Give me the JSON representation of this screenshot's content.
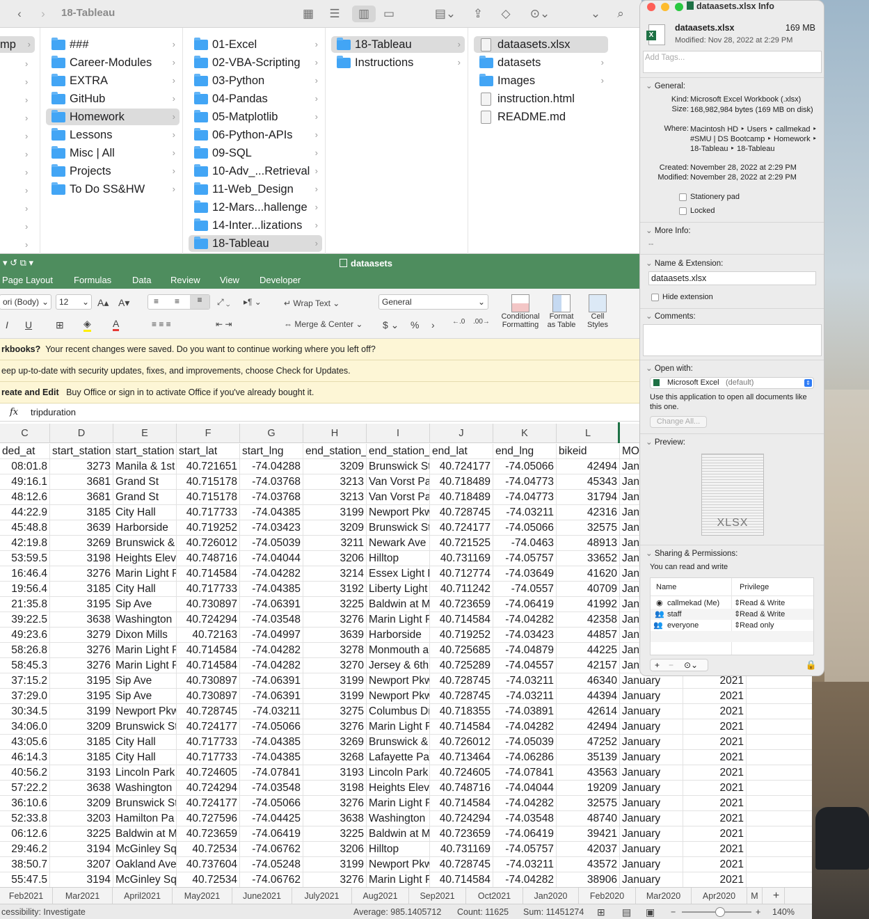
{
  "finder": {
    "title": "18-Tableau",
    "col0": [
      {
        "label": "mp",
        "selected": true
      }
    ],
    "col1": [
      {
        "label": "###",
        "selected": false
      },
      {
        "label": "Career-Modules",
        "selected": false
      },
      {
        "label": "EXTRA",
        "selected": false
      },
      {
        "label": "GitHub",
        "selected": false
      },
      {
        "label": "Homework",
        "selected": true
      },
      {
        "label": "Lessons",
        "selected": false
      },
      {
        "label": "Misc | All",
        "selected": false
      },
      {
        "label": "Projects",
        "selected": false
      },
      {
        "label": "To Do SS&HW",
        "selected": false
      }
    ],
    "col2": [
      {
        "label": "01-Excel",
        "selected": false
      },
      {
        "label": "02-VBA-Scripting",
        "selected": false
      },
      {
        "label": "03-Python",
        "selected": false
      },
      {
        "label": "04-Pandas",
        "selected": false
      },
      {
        "label": "05-Matplotlib",
        "selected": false
      },
      {
        "label": "06-Python-APIs",
        "selected": false
      },
      {
        "label": "09-SQL",
        "selected": false
      },
      {
        "label": "10-Adv_...Retrieval",
        "selected": false
      },
      {
        "label": "11-Web_Design",
        "selected": false
      },
      {
        "label": "12-Mars...hallenge",
        "selected": false
      },
      {
        "label": "14-Inter...lizations",
        "selected": false
      },
      {
        "label": "18-Tableau",
        "selected": true
      }
    ],
    "col3": [
      {
        "label": "18-Tableau",
        "selected": true
      },
      {
        "label": "Instructions",
        "selected": false
      }
    ],
    "col4": [
      {
        "label": "dataasets.xlsx",
        "selected": true,
        "kind": "file",
        "chevron": false
      },
      {
        "label": "datasets",
        "selected": false,
        "kind": "folder",
        "chevron": true
      },
      {
        "label": "Images",
        "selected": false,
        "kind": "folder",
        "chevron": true
      },
      {
        "label": "instruction.html",
        "selected": false,
        "kind": "file",
        "chevron": false
      },
      {
        "label": "README.md",
        "selected": false,
        "kind": "file",
        "chevron": false
      }
    ]
  },
  "excel": {
    "title": "dataasets",
    "menu": [
      "Page Layout",
      "Formulas",
      "Data",
      "Review",
      "View",
      "Developer"
    ],
    "font_name": "ori (Body)",
    "font_size": "12",
    "wrap_text": "Wrap Text",
    "merge_center": "Merge & Center",
    "number_format": "General",
    "conditional_formatting": "Conditional\nFormatting",
    "format_as_table": "Format\nas Table",
    "cell_styles": "Cell\nStyles",
    "notices": [
      {
        "bold": "rkbooks?",
        "text": "Your recent changes were saved. Do you want to continue working where you left off?"
      },
      {
        "bold": "",
        "text": "eep up-to-date with security updates, fixes, and improvements, choose Check for Updates."
      },
      {
        "bold": "reate and Edit",
        "text": "Buy Office or sign in to activate Office if you've already bought it."
      }
    ],
    "fx": "fx",
    "formula_value": "tripduration",
    "columns": [
      "C",
      "D",
      "E",
      "F",
      "G",
      "H",
      "I",
      "J",
      "K",
      "L"
    ],
    "header_row": [
      "ded_at",
      "start_station",
      "start_station",
      "start_lat",
      "start_lng",
      "end_station_",
      "end_station_",
      "end_lat",
      "end_lng",
      "bikeid",
      "MO"
    ],
    "rows": [
      [
        "08:01.8",
        "3273",
        "Manila & 1st",
        "40.721651",
        "-74.04288",
        "3209",
        "Brunswick St",
        "40.724177",
        "-74.05066",
        "42494",
        "Janu",
        ""
      ],
      [
        "49:16.1",
        "3681",
        "Grand St",
        "40.715178",
        "-74.03768",
        "3213",
        "Van Vorst Pa",
        "40.718489",
        "-74.04773",
        "45343",
        "Janu",
        ""
      ],
      [
        "48:12.6",
        "3681",
        "Grand St",
        "40.715178",
        "-74.03768",
        "3213",
        "Van Vorst Pa",
        "40.718489",
        "-74.04773",
        "31794",
        "Janu",
        ""
      ],
      [
        "44:22.9",
        "3185",
        "City Hall",
        "40.717733",
        "-74.04385",
        "3199",
        "Newport Pkw",
        "40.728745",
        "-74.03211",
        "42316",
        "Janu",
        ""
      ],
      [
        "45:48.8",
        "3639",
        "Harborside",
        "40.719252",
        "-74.03423",
        "3209",
        "Brunswick St",
        "40.724177",
        "-74.05066",
        "32575",
        "Janu",
        ""
      ],
      [
        "42:19.8",
        "3269",
        "Brunswick &",
        "40.726012",
        "-74.05039",
        "3211",
        "Newark Ave",
        "40.721525",
        "-74.0463",
        "48913",
        "Janu",
        ""
      ],
      [
        "53:59.5",
        "3198",
        "Heights Eleva",
        "40.748716",
        "-74.04044",
        "3206",
        "Hilltop",
        "40.731169",
        "-74.05757",
        "33652",
        "Janu",
        ""
      ],
      [
        "16:46.4",
        "3276",
        "Marin Light R",
        "40.714584",
        "-74.04282",
        "3214",
        "Essex Light R",
        "40.712774",
        "-74.03649",
        "41620",
        "Janu",
        ""
      ],
      [
        "19:56.4",
        "3185",
        "City Hall",
        "40.717733",
        "-74.04385",
        "3192",
        "Liberty Light",
        "40.711242",
        "-74.0557",
        "40709",
        "Janu",
        ""
      ],
      [
        "21:35.8",
        "3195",
        "Sip Ave",
        "40.730897",
        "-74.06391",
        "3225",
        "Baldwin at M",
        "40.723659",
        "-74.06419",
        "41992",
        "Janu",
        ""
      ],
      [
        "39:22.5",
        "3638",
        "Washington",
        "40.724294",
        "-74.03548",
        "3276",
        "Marin Light R",
        "40.714584",
        "-74.04282",
        "42358",
        "Janu",
        ""
      ],
      [
        "49:23.6",
        "3279",
        "Dixon Mills",
        "40.72163",
        "-74.04997",
        "3639",
        "Harborside",
        "40.719252",
        "-74.03423",
        "44857",
        "Janu",
        ""
      ],
      [
        "58:26.8",
        "3276",
        "Marin Light R",
        "40.714584",
        "-74.04282",
        "3278",
        "Monmouth a",
        "40.725685",
        "-74.04879",
        "44225",
        "Janu",
        ""
      ],
      [
        "58:45.3",
        "3276",
        "Marin Light R",
        "40.714584",
        "-74.04282",
        "3270",
        "Jersey & 6th",
        "40.725289",
        "-74.04557",
        "42157",
        "Janu",
        ""
      ],
      [
        "37:15.2",
        "3195",
        "Sip Ave",
        "40.730897",
        "-74.06391",
        "3199",
        "Newport Pkw",
        "40.728745",
        "-74.03211",
        "46340",
        "January",
        "2021"
      ],
      [
        "37:29.0",
        "3195",
        "Sip Ave",
        "40.730897",
        "-74.06391",
        "3199",
        "Newport Pkw",
        "40.728745",
        "-74.03211",
        "44394",
        "January",
        "2021"
      ],
      [
        "30:34.5",
        "3199",
        "Newport Pkw",
        "40.728745",
        "-74.03211",
        "3275",
        "Columbus Dr",
        "40.718355",
        "-74.03891",
        "42614",
        "January",
        "2021"
      ],
      [
        "34:06.0",
        "3209",
        "Brunswick St",
        "40.724177",
        "-74.05066",
        "3276",
        "Marin Light R",
        "40.714584",
        "-74.04282",
        "42494",
        "January",
        "2021"
      ],
      [
        "43:05.6",
        "3185",
        "City Hall",
        "40.717733",
        "-74.04385",
        "3269",
        "Brunswick &",
        "40.726012",
        "-74.05039",
        "47252",
        "January",
        "2021"
      ],
      [
        "46:14.3",
        "3185",
        "City Hall",
        "40.717733",
        "-74.04385",
        "3268",
        "Lafayette Pa",
        "40.713464",
        "-74.06286",
        "35139",
        "January",
        "2021"
      ],
      [
        "40:56.2",
        "3193",
        "Lincoln Park",
        "40.724605",
        "-74.07841",
        "3193",
        "Lincoln Park",
        "40.724605",
        "-74.07841",
        "43563",
        "January",
        "2021"
      ],
      [
        "57:22.2",
        "3638",
        "Washington",
        "40.724294",
        "-74.03548",
        "3198",
        "Heights Eleva",
        "40.748716",
        "-74.04044",
        "19209",
        "January",
        "2021"
      ],
      [
        "36:10.6",
        "3209",
        "Brunswick St",
        "40.724177",
        "-74.05066",
        "3276",
        "Marin Light R",
        "40.714584",
        "-74.04282",
        "32575",
        "January",
        "2021"
      ],
      [
        "52:33.8",
        "3203",
        "Hamilton Pa",
        "40.727596",
        "-74.04425",
        "3638",
        "Washington",
        "40.724294",
        "-74.03548",
        "48740",
        "January",
        "2021"
      ],
      [
        "06:12.6",
        "3225",
        "Baldwin at M",
        "40.723659",
        "-74.06419",
        "3225",
        "Baldwin at M",
        "40.723659",
        "-74.06419",
        "39421",
        "January",
        "2021"
      ],
      [
        "29:46.2",
        "3194",
        "McGinley Sq",
        "40.72534",
        "-74.06762",
        "3206",
        "Hilltop",
        "40.731169",
        "-74.05757",
        "42037",
        "January",
        "2021"
      ],
      [
        "38:50.7",
        "3207",
        "Oakland Ave",
        "40.737604",
        "-74.05248",
        "3199",
        "Newport Pkw",
        "40.728745",
        "-74.03211",
        "43572",
        "January",
        "2021"
      ],
      [
        "55:47.5",
        "3194",
        "McGinley Sq",
        "40.72534",
        "-74.06762",
        "3276",
        "Marin Light R",
        "40.714584",
        "-74.04282",
        "38906",
        "January",
        "2021"
      ]
    ],
    "sheets": [
      "Feb2021",
      "Mar2021",
      "April2021",
      "May2021",
      "June2021",
      "July2021",
      "Aug2021",
      "Sep2021",
      "Oct2021",
      "Jan2020",
      "Feb2020",
      "Mar2020",
      "Apr2020",
      "M"
    ],
    "add_sheet": "+",
    "status": {
      "accessibility": "cessibility: Investigate",
      "average": "Average: 985.1405712",
      "count": "Count: 11625",
      "sum": "Sum: 11451274",
      "zoom": "140%"
    }
  },
  "info": {
    "title": "dataasets.xlsx Info",
    "filename": "dataasets.xlsx",
    "size": "169 MB",
    "modified_header": "Modified: Nov 28, 2022 at 2:29 PM",
    "tags_placeholder": "Add Tags...",
    "general_label": "General:",
    "general": [
      {
        "key": "Kind:",
        "value": "Microsoft Excel Workbook (.xlsx)"
      },
      {
        "key": "Size:",
        "value": "168,982,984 bytes (169 MB on disk)"
      },
      {
        "key": "Where:",
        "value": "Macintosh HD ‣ Users ‣ callmekad ‣ #SMU | DS Bootcamp ‣ Homework ‣ 18-Tableau ‣ 18-Tableau"
      },
      {
        "key": "Created:",
        "value": "November 28, 2022 at 2:29 PM"
      },
      {
        "key": "Modified:",
        "value": "November 28, 2022 at 2:29 PM"
      }
    ],
    "stationery": "Stationery pad",
    "locked": "Locked",
    "more_info_label": "More Info:",
    "more_info_value": "--",
    "name_ext_label": "Name & Extension:",
    "name_value": "dataasets.xlsx",
    "hide_extension": "Hide extension",
    "comments_label": "Comments:",
    "open_with_label": "Open with:",
    "open_with_app": "Microsoft Excel",
    "open_with_default": "(default)",
    "open_with_note": "Use this application to open all documents like this one.",
    "change_all": "Change All...",
    "preview_label": "Preview:",
    "preview_badge": "XLSX",
    "sharing_label": "Sharing & Permissions:",
    "sharing_note": "You can read and write",
    "perm_headers": [
      "Name",
      "Privilege"
    ],
    "permissions": [
      {
        "name": "callmekad (Me)",
        "privilege": "Read & Write"
      },
      {
        "name": "staff",
        "privilege": "Read & Write"
      },
      {
        "name": "everyone",
        "privilege": "Read only"
      }
    ]
  },
  "colors": {
    "excel_green": "#4e8d5e",
    "finder_blue": "#42a5f5",
    "notice_yellow": "#fdf6d6"
  }
}
